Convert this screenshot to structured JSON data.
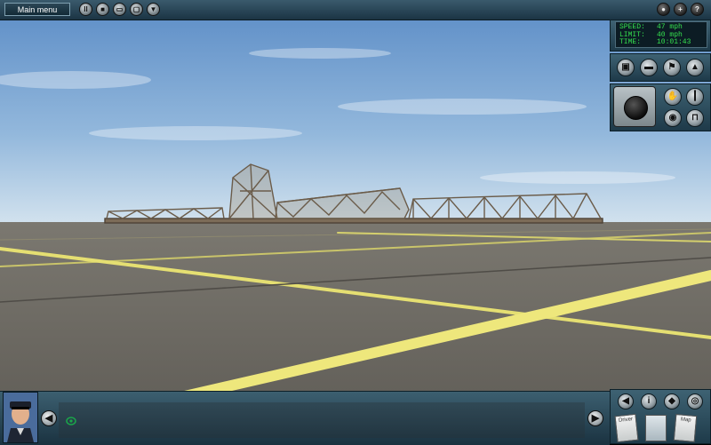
{
  "topbar": {
    "main_menu_label": "Main menu",
    "left_buttons": [
      {
        "icon": "pause-icon",
        "glyph": "II"
      },
      {
        "icon": "stop-icon",
        "glyph": "■"
      },
      {
        "icon": "save-icon",
        "glyph": "▭"
      },
      {
        "icon": "screen-icon",
        "glyph": "▢"
      },
      {
        "icon": "down-icon",
        "glyph": "▼"
      }
    ],
    "right_buttons": [
      {
        "icon": "record-icon",
        "glyph": "●"
      },
      {
        "icon": "add-icon",
        "glyph": "+"
      },
      {
        "icon": "help-icon",
        "glyph": "?"
      }
    ]
  },
  "hud": {
    "speed_label": "SPEED:",
    "speed_value": "47 mph",
    "limit_label": "LIMIT:",
    "limit_value": "40 mph",
    "time_label": "TIME:",
    "time_value": "10:01:43"
  },
  "camera_buttons": [
    {
      "icon": "cab-view-icon",
      "glyph": "▣"
    },
    {
      "icon": "external-view-icon",
      "glyph": "▬"
    },
    {
      "icon": "lineside-view-icon",
      "glyph": "⚑"
    },
    {
      "icon": "free-roam-icon",
      "glyph": "▲"
    }
  ],
  "control_buttons": [
    {
      "icon": "hand-icon",
      "glyph": "✋"
    },
    {
      "icon": "lever-icon",
      "glyph": "┃"
    },
    {
      "icon": "brake-icon",
      "glyph": "◉"
    },
    {
      "icon": "seat-icon",
      "glyph": "⊓"
    }
  ],
  "bottom_right_buttons": [
    {
      "icon": "volume-icon",
      "glyph": "◀"
    },
    {
      "icon": "info-icon",
      "glyph": "i"
    },
    {
      "icon": "direction-icon",
      "glyph": "◆"
    },
    {
      "icon": "eye-icon",
      "glyph": "◎"
    }
  ],
  "documents": [
    {
      "icon": "document-icon-1",
      "label": "Driver"
    },
    {
      "icon": "document-icon-2",
      "label": ""
    },
    {
      "icon": "document-icon-3",
      "label": "Map"
    }
  ],
  "colors": {
    "sky_top": "#5f8fc8",
    "sky_bottom": "#c9dcec",
    "ground": "#6e6a62",
    "yellow_line": "#e9e273",
    "hud_text": "#35e04f"
  }
}
